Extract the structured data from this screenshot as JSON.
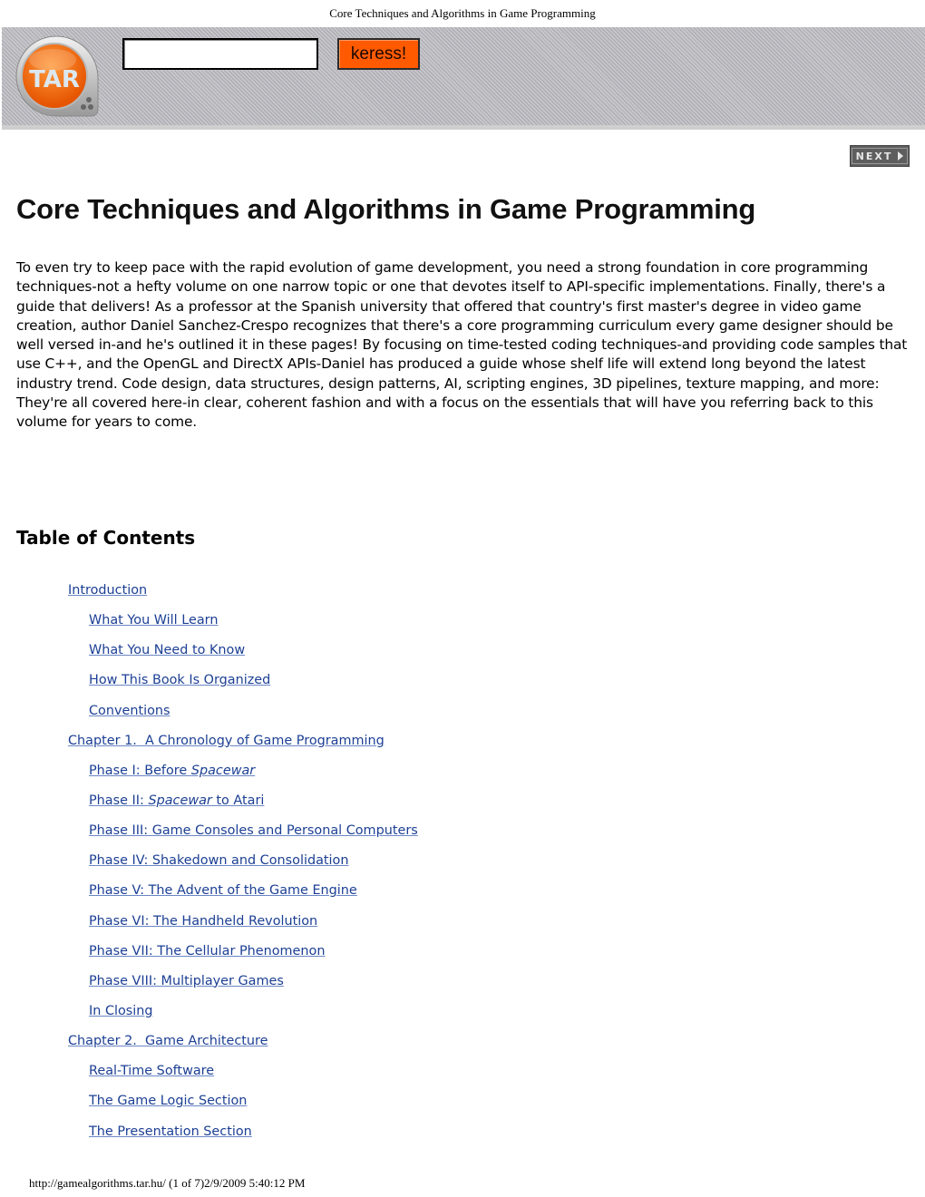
{
  "print_header": "Core Techniques and Algorithms in Game Programming",
  "banner": {
    "logo_text": "TAR",
    "search_placeholder": "",
    "search_value": "",
    "search_button": "keress!",
    "accent_color": "#ff5a00"
  },
  "nav": {
    "next_label": "NEXT"
  },
  "page_title": "Core Techniques and Algorithms in Game Programming",
  "description": "To even try to keep pace with the rapid evolution of game development, you need a strong foundation in core programming techniques-not a hefty volume on one narrow topic or one that devotes itself to API-specific implementations. Finally, there's a guide that delivers! As a professor at the Spanish university that offered that country's first master's degree in video game creation, author Daniel Sanchez-Crespo recognizes that there's a core programming curriculum every game designer should be well versed in-and he's outlined it in these pages! By focusing on time-tested coding techniques-and providing code samples that use C++, and the OpenGL and DirectX APIs-Daniel has produced a guide whose shelf life will extend long beyond the latest industry trend. Code design, data structures, design patterns, AI, scripting engines, 3D pipelines, texture mapping, and more: They're all covered here-in clear, coherent fashion and with a focus on the essentials that will have you referring back to this volume for years to come.",
  "toc": {
    "heading": "Table of Contents",
    "items": [
      {
        "level": 1,
        "label": "Introduction"
      },
      {
        "level": 2,
        "label": "What You Will Learn"
      },
      {
        "level": 2,
        "label": "What You Need to Know"
      },
      {
        "level": 2,
        "label": "How This Book Is Organized"
      },
      {
        "level": 2,
        "label": "Conventions"
      },
      {
        "level": 1,
        "label": "Chapter 1.  A Chronology of Game Programming"
      },
      {
        "level": 2,
        "prefix": "Phase I: Before ",
        "italic": "Spacewar",
        "suffix": ""
      },
      {
        "level": 2,
        "prefix": "Phase II: ",
        "italic": "Spacewar",
        "suffix": " to Atari"
      },
      {
        "level": 2,
        "label": "Phase III: Game Consoles and Personal Computers"
      },
      {
        "level": 2,
        "label": "Phase IV: Shakedown and Consolidation"
      },
      {
        "level": 2,
        "label": "Phase V: The Advent of the Game Engine"
      },
      {
        "level": 2,
        "label": "Phase VI: The Handheld Revolution"
      },
      {
        "level": 2,
        "label": "Phase VII: The Cellular Phenomenon"
      },
      {
        "level": 2,
        "label": "Phase VIII: Multiplayer Games"
      },
      {
        "level": 2,
        "label": "In Closing"
      },
      {
        "level": 1,
        "label": "Chapter 2.  Game Architecture"
      },
      {
        "level": 2,
        "label": "Real-Time Software"
      },
      {
        "level": 2,
        "label": "The Game Logic Section"
      },
      {
        "level": 2,
        "label": "The Presentation Section"
      }
    ]
  },
  "print_footer": "http://gamealgorithms.tar.hu/ (1 of 7)2/9/2009 5:40:12 PM"
}
